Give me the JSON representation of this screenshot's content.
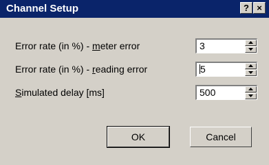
{
  "window": {
    "title": "Channel Setup",
    "help_glyph": "?",
    "close_glyph": "×"
  },
  "fields": [
    {
      "label_pre": "Error rate (in %) - ",
      "label_accel": "m",
      "label_post": "eter error",
      "value": "3"
    },
    {
      "label_pre": "Error rate (in %) - ",
      "label_accel": "r",
      "label_post": "eading error",
      "value": "5"
    },
    {
      "label_pre": "",
      "label_accel": "S",
      "label_post": "imulated delay [ms]",
      "value": "500"
    }
  ],
  "buttons": {
    "ok": "OK",
    "cancel": "Cancel"
  },
  "icons": {
    "spin_up": "chevron-up-icon",
    "spin_down": "chevron-down-icon"
  },
  "colors": {
    "titlebar": "#0a246a",
    "dialog_bg": "#d4d0c8"
  }
}
